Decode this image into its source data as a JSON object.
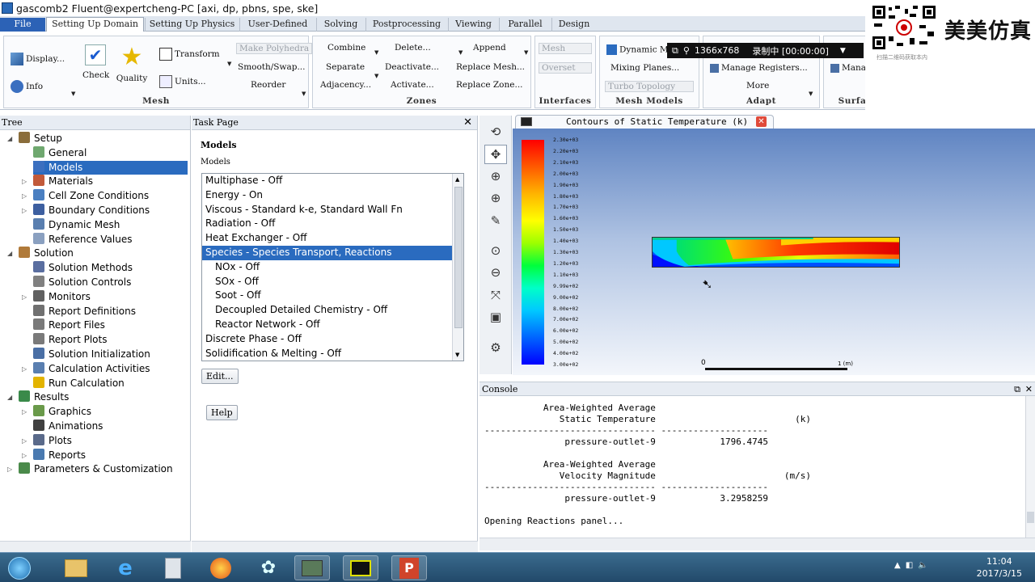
{
  "window": {
    "title": "gascomb2 Fluent@expertcheng-PC  [axi, dp, pbns, spe, ske]"
  },
  "menu": {
    "tabs": [
      "File",
      "Setting Up Domain",
      "Setting Up Physics",
      "User-Defined",
      "Solving",
      "Postprocessing",
      "Viewing",
      "Parallel",
      "Design"
    ],
    "active": "Setting Up Domain"
  },
  "ribbon": {
    "mesh": {
      "label": "Mesh",
      "display": "Display...",
      "info": "Info",
      "check": "Check",
      "quality": "Quality",
      "transform": "Transform",
      "units": "Units...",
      "make_polyhedra": "Make Polyhedra",
      "smooth_swap": "Smooth/Swap...",
      "reorder": "Reorder"
    },
    "zones": {
      "label": "Zones",
      "combine": "Combine",
      "separate": "Separate",
      "adjacency": "Adjacency...",
      "delete": "Delete...",
      "deactivate": "Deactivate...",
      "activate": "Activate...",
      "append": "Append",
      "replace_mesh": "Replace Mesh...",
      "replace_zone": "Replace Zone..."
    },
    "interfaces": {
      "label": "Interfaces",
      "mesh": "Mesh",
      "overset": "Overset"
    },
    "mesh_models": {
      "label": "Mesh Models",
      "dynamic_mesh": "Dynamic Mesh",
      "mixing_planes": "Mixing Planes...",
      "turbo_topology": "Turbo Topology"
    },
    "adapt": {
      "label": "Adapt",
      "manage_registers": "Manage Registers...",
      "more": "More"
    },
    "surface": {
      "label": "Surface",
      "manage": "Mana"
    }
  },
  "watermark": {
    "brand": "美美仿真",
    "qr_caption": "扫描二维码获取本内",
    "recorder_resolution": "1366x768",
    "recorder_status": "录制中 [00:00:00]"
  },
  "tree": {
    "header": "Tree",
    "items": [
      {
        "label": "Setup",
        "color": "#8a6d3b"
      },
      {
        "label": "General",
        "color": "#6fa86f"
      },
      {
        "label": "Models",
        "color": "#3b6fbf"
      },
      {
        "label": "Materials",
        "color": "#c25a3a"
      },
      {
        "label": "Cell Zone Conditions",
        "color": "#4a7fc1"
      },
      {
        "label": "Boundary Conditions",
        "color": "#3d5fa0"
      },
      {
        "label": "Dynamic Mesh",
        "color": "#5a7fb0"
      },
      {
        "label": "Reference Values",
        "color": "#8aa0c0"
      },
      {
        "label": "Solution",
        "color": "#b07a3a"
      },
      {
        "label": "Solution Methods",
        "color": "#5a6ea0"
      },
      {
        "label": "Solution Controls",
        "color": "#808080"
      },
      {
        "label": "Monitors",
        "color": "#606060"
      },
      {
        "label": "Report Definitions",
        "color": "#707070"
      },
      {
        "label": "Report Files",
        "color": "#7a7a7a"
      },
      {
        "label": "Report Plots",
        "color": "#7a7a7a"
      },
      {
        "label": "Solution Initialization",
        "color": "#4a6fa5"
      },
      {
        "label": "Calculation Activities",
        "color": "#5a7fb0"
      },
      {
        "label": "Run Calculation",
        "color": "#e3b400"
      },
      {
        "label": "Results",
        "color": "#3a8a4a"
      },
      {
        "label": "Graphics",
        "color": "#6a9a4a"
      },
      {
        "label": "Animations",
        "color": "#404040"
      },
      {
        "label": "Plots",
        "color": "#5a6a8a"
      },
      {
        "label": "Reports",
        "color": "#4a7ab0"
      },
      {
        "label": "Parameters & Customization",
        "color": "#4a8a4a"
      }
    ]
  },
  "task": {
    "header": "Task Page",
    "title": "Models",
    "list_label": "Models",
    "models": [
      "Multiphase - Off",
      "Energy - On",
      "Viscous - Standard k-e, Standard Wall Fn",
      "Radiation - Off",
      "Heat Exchanger - Off",
      "Species - Species Transport, Reactions",
      "NOx - Off",
      "SOx - Off",
      "Soot - Off",
      "Decoupled Detailed Chemistry - Off",
      "Reactor Network - Off",
      "Discrete Phase - Off",
      "Solidification & Melting - Off"
    ],
    "selected_index": 5,
    "edit_button": "Edit...",
    "help_button": "Help"
  },
  "graphics": {
    "tab_title": "Contours of Static Temperature (k)",
    "colorbar_labels": [
      "2.30e+03",
      "2.20e+03",
      "2.10e+03",
      "2.00e+03",
      "1.90e+03",
      "1.80e+03",
      "1.70e+03",
      "1.60e+03",
      "1.50e+03",
      "1.40e+03",
      "1.30e+03",
      "1.20e+03",
      "1.10e+03",
      "9.99e+02",
      "9.00e+02",
      "8.00e+02",
      "7.00e+02",
      "6.00e+02",
      "5.00e+02",
      "4.00e+02",
      "3.00e+02"
    ],
    "scale_start": "0",
    "scale_end": "1 (m)"
  },
  "console": {
    "header": "Console",
    "lines": [
      "           Area-Weighted Average",
      "              Static Temperature                          (k)",
      "-------------------------------- --------------------",
      "               pressure-outlet-9            1796.4745",
      "",
      "           Area-Weighted Average",
      "              Velocity Magnitude                        (m/s)",
      "-------------------------------- --------------------",
      "               pressure-outlet-9            3.2958259",
      "",
      "Opening Reactions panel..."
    ]
  },
  "taskbar": {
    "time": "11:04",
    "date": "2017/3/15"
  }
}
